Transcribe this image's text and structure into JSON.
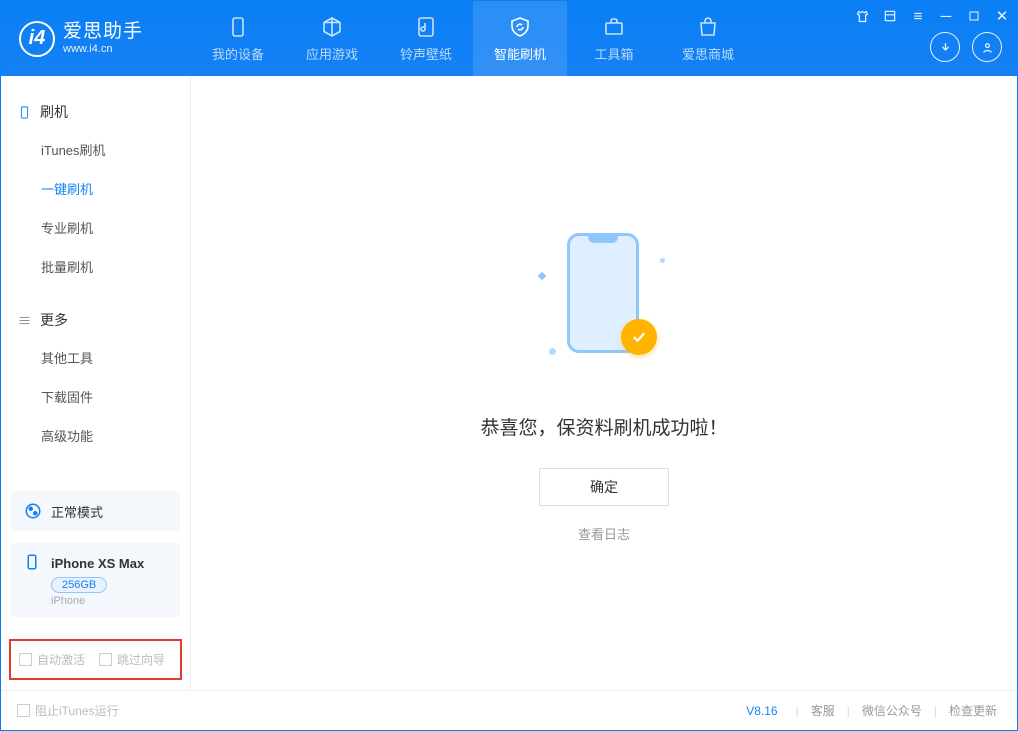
{
  "app": {
    "name_cn": "爱思助手",
    "url": "www.i4.cn"
  },
  "nav": [
    {
      "id": "device",
      "label": "我的设备"
    },
    {
      "id": "apps",
      "label": "应用游戏"
    },
    {
      "id": "ring",
      "label": "铃声壁纸"
    },
    {
      "id": "flash",
      "label": "智能刷机"
    },
    {
      "id": "tools",
      "label": "工具箱"
    },
    {
      "id": "store",
      "label": "爱思商城"
    }
  ],
  "sidebar": {
    "section1": "刷机",
    "items1": [
      "iTunes刷机",
      "一键刷机",
      "专业刷机",
      "批量刷机"
    ],
    "section2": "更多",
    "items2": [
      "其他工具",
      "下载固件",
      "高级功能"
    ]
  },
  "mode": {
    "label": "正常模式"
  },
  "device": {
    "name": "iPhone XS Max",
    "storage": "256GB",
    "type": "iPhone"
  },
  "red_options": {
    "auto_activate": "自动激活",
    "skip_wizard": "跳过向导"
  },
  "main": {
    "success_msg": "恭喜您，保资料刷机成功啦！",
    "ok": "确定",
    "view_log": "查看日志"
  },
  "footer": {
    "block_itunes": "阻止iTunes运行",
    "version": "V8.16",
    "support": "客服",
    "wechat": "微信公众号",
    "update": "检查更新"
  }
}
